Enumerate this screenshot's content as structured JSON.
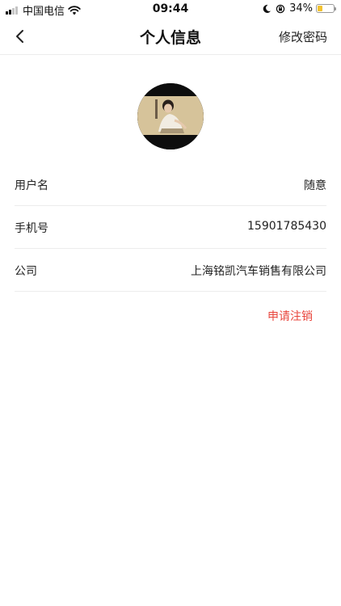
{
  "status_bar": {
    "carrier": "中国电信",
    "time": "09:44",
    "battery_percent": "34%",
    "battery_level": 0.34,
    "signal_bars_active": 2,
    "signal_bars_total": 4,
    "icons": [
      "signal-icon",
      "wifi-icon",
      "moon-icon",
      "orientation-lock-icon",
      "battery-icon"
    ]
  },
  "nav": {
    "back_icon": "chevron-left-icon",
    "title": "个人信息",
    "action": "修改密码"
  },
  "profile": {
    "avatar": "avatar"
  },
  "rows": [
    {
      "label": "用户名",
      "value": "随意"
    },
    {
      "label": "手机号",
      "value": "15901785430"
    },
    {
      "label": "公司",
      "value": "上海铭凯汽车销售有限公司"
    }
  ],
  "cancel_action": "申请注销",
  "colors": {
    "accent_red": "#e8453c",
    "divider": "#ececec",
    "battery": "#f2c230"
  }
}
